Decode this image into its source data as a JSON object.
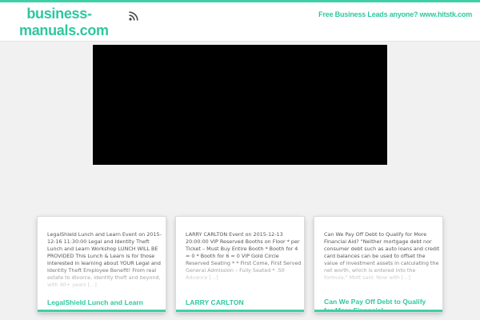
{
  "header": {
    "logo_text": "business-manuals.com",
    "promo_text": "Free Business Leads anyone? www.hitstk.com"
  },
  "icons": {
    "feed": "rss-icon"
  },
  "colors": {
    "accent": "#3ed0a8",
    "background": "#f1f1f1",
    "video": "#000000"
  },
  "posts": [
    {
      "excerpt": "LegalShield Lunch and Learn Event on 2015-12-16 11:30:00 Legal and Identity Theft Lunch and Learn Workshop LUNCH WILL BE PROVIDED This Lunch & Learn is for those interested in learning about YOUR Legal and Identity Theft Employee Benefit! From real estate to divorce, identity theft and beyond, with 40+ years [...]",
      "title": "LegalShield Lunch and Learn"
    },
    {
      "excerpt": "LARRY CARLTON Event on 2015-12-13 20:00:00 VIP Reserved Booths on Floor * per Ticket – Must Buy Entire Booth * Booth for 4 = 0 * Booth for 6 = 0 VIP Gold Circle Reserved Seating * * First Come, First Served General Admission – Fully Seated * .50 Advance [...]",
      "title": "LARRY CARLTON"
    },
    {
      "excerpt": "Can We Pay Off Debt to Qualify for More Financial Aid? \"Neither mortgage debt nor consumer debt such as auto loans and credit card balances can be used to offset the value of investment assets in calculating the net worth, which is entered into the formula,\" Mott said. Now with [...]",
      "title": "Can We Pay Off Debt to Qualify for More Financial ..."
    }
  ]
}
